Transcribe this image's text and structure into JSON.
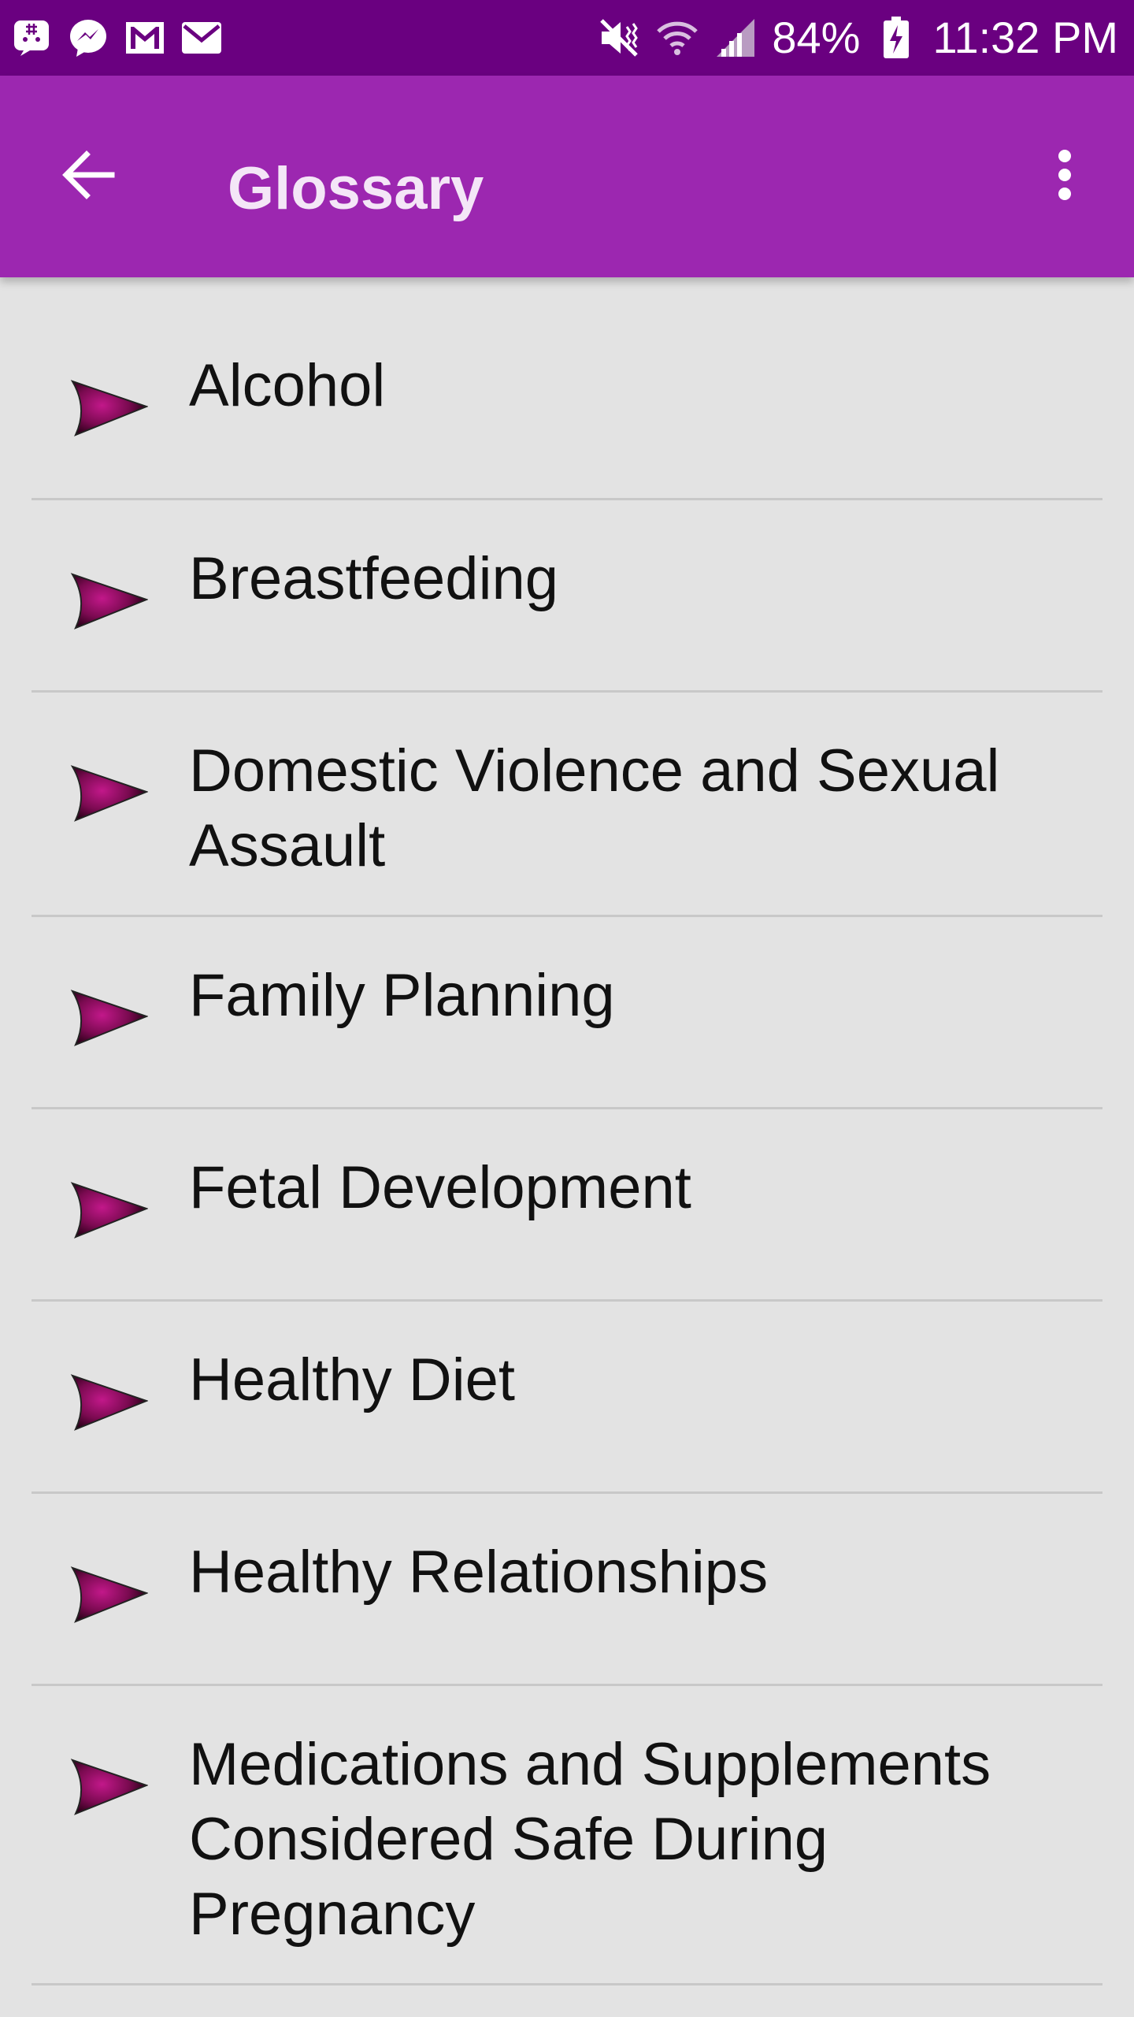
{
  "status_bar": {
    "battery_percent": "84%",
    "time": "11:32 PM",
    "icons_left": [
      "chat-bubble-icon",
      "messenger-icon",
      "gmail-icon",
      "email-icon"
    ],
    "icons_right": [
      "vibrate-mute-icon",
      "wifi-icon",
      "signal-icon",
      "battery-charging-icon"
    ]
  },
  "app_bar": {
    "title": "Glossary",
    "back_icon": "arrow-back-icon",
    "menu_icon": "more-vert-icon",
    "background": "#9c27b0",
    "status_background": "#6a0080"
  },
  "glossary": {
    "items": [
      {
        "label": "Alcohol"
      },
      {
        "label": "Breastfeeding"
      },
      {
        "label": "Domestic Violence and Sexual Assault"
      },
      {
        "label": "Family Planning"
      },
      {
        "label": "Fetal Development"
      },
      {
        "label": "Healthy Diet"
      },
      {
        "label": "Healthy Relationships"
      },
      {
        "label": "Medications and Supplements Considered Safe During Pregnancy"
      }
    ],
    "bullet_icon": "arrowhead-bullet-icon",
    "bullet_color": "#8b0a5a"
  }
}
